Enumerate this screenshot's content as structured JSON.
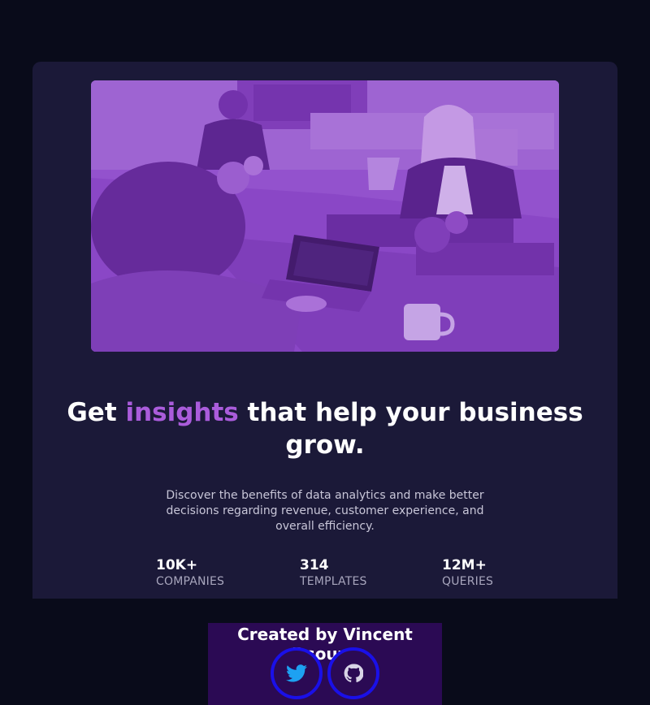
{
  "hero": {
    "image_alt": "People working at a shared office table with laptops",
    "tint_color": "#8c4bc8"
  },
  "headline": {
    "part1": "Get ",
    "accent": "insights",
    "part2": " that help your business grow."
  },
  "description": "Discover the benefits of data analytics and make better decisions regarding revenue, customer experience, and overall efficiency.",
  "stats": [
    {
      "value": "10K+",
      "label": "Companies"
    },
    {
      "value": "314",
      "label": "Templates"
    },
    {
      "value": "12M+",
      "label": "Queries"
    }
  ],
  "footer": {
    "credit": "Created by Vincent Dsouza",
    "links": [
      {
        "icon": "twitter-icon"
      },
      {
        "icon": "github-icon"
      }
    ]
  },
  "colors": {
    "background": "#090b1a",
    "card": "#1b1938",
    "accent": "#aa5cdb",
    "footer": "#2b0a54",
    "ring": "#1a10e8",
    "twitter": "#1da1f2"
  }
}
